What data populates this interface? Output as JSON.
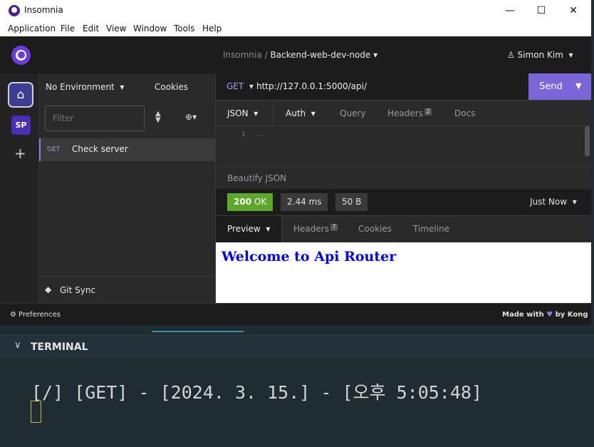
{
  "window": {
    "title": "Insomnia",
    "controls": {
      "minimize": "—",
      "maximize": "☐",
      "close": "✕"
    }
  },
  "menu": [
    "Application",
    "File",
    "Edit",
    "View",
    "Window",
    "Tools",
    "Help"
  ],
  "header": {
    "breadcrumb_root": "Insomnia",
    "breadcrumb_sep": "/",
    "breadcrumb_current": "Backend-web-dev-node",
    "user": "Simon Kim"
  },
  "rail": {
    "workspace_badge": "SP"
  },
  "sidebar": {
    "environment": "No Environment",
    "cookies": "Cookies",
    "filter_placeholder": "Filter",
    "request": {
      "method": "GET",
      "name": "Check server"
    },
    "git_sync": "Git Sync"
  },
  "request": {
    "method": "GET",
    "url": "http://127.0.0.1:5000/api/",
    "send": "Send",
    "tabs": {
      "body": "JSON",
      "auth": "Auth",
      "query": "Query",
      "headers": "Headers",
      "headers_count": "2",
      "docs": "Docs"
    },
    "editor": {
      "line": "1",
      "code": "..."
    },
    "beautify": "Beautify JSON"
  },
  "response": {
    "status_code": "200",
    "status_text": "OK",
    "time": "2.44 ms",
    "size": "50 B",
    "when": "Just Now",
    "tabs": {
      "preview": "Preview",
      "headers": "Headers",
      "headers_count": "7",
      "cookies": "Cookies",
      "timeline": "Timeline"
    },
    "preview_heading": "Welcome to Api Router"
  },
  "footer": {
    "preferences": "Preferences",
    "made_with": "Made with",
    "by": "by Kong"
  },
  "terminal": {
    "title": "TERMINAL",
    "output": "[/] [GET] - [2024. 3. 15.] - [오후 5:05:48]"
  },
  "colors": {
    "accent": "#7a66d8",
    "status_ok": "#5ca92a",
    "link": "#0000ee"
  }
}
